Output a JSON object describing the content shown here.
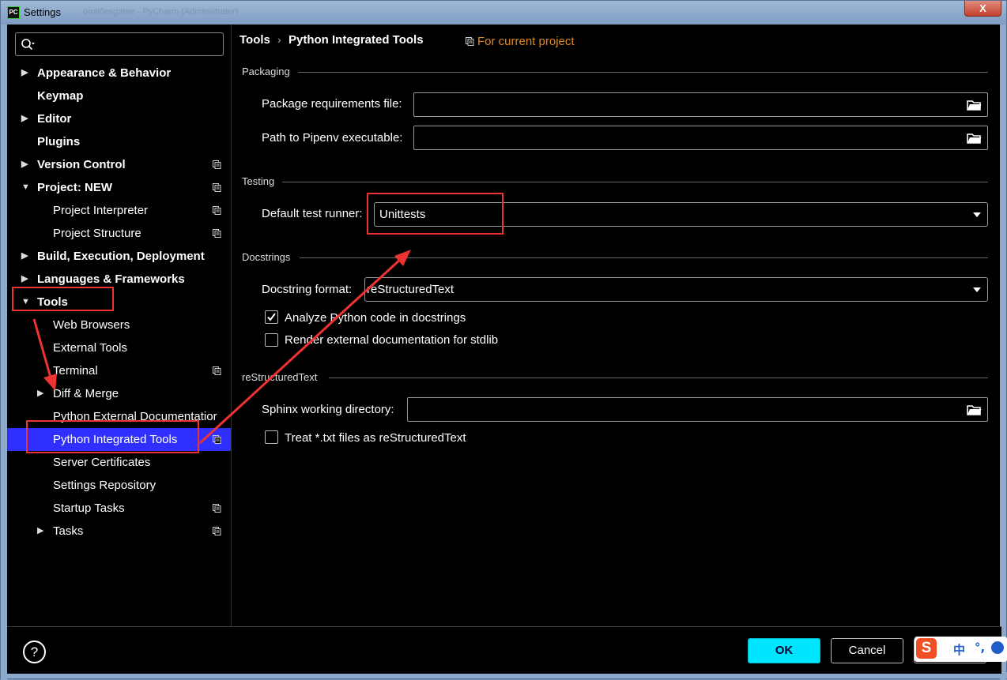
{
  "window": {
    "title": "Settings",
    "app_icon_text": "PC",
    "ghost_title": "...onal/lesgame - PyCharm (Administrator)",
    "close_label": "X"
  },
  "search": {
    "placeholder": ""
  },
  "sidebar": {
    "items": [
      {
        "label": "Appearance & Behavior",
        "bold": true,
        "arrow": "▶"
      },
      {
        "label": "Keymap",
        "bold": true,
        "arrow": ""
      },
      {
        "label": "Editor",
        "bold": true,
        "arrow": "▶"
      },
      {
        "label": "Plugins",
        "bold": true,
        "arrow": ""
      },
      {
        "label": "Version Control",
        "bold": true,
        "arrow": "▶"
      },
      {
        "label": "Project: NEW",
        "bold": true,
        "arrow": "▼"
      },
      {
        "label": "Project Interpreter",
        "bold": false,
        "arrow": ""
      },
      {
        "label": "Project Structure",
        "bold": false,
        "arrow": ""
      },
      {
        "label": "Build, Execution, Deployment",
        "bold": true,
        "arrow": "▶"
      },
      {
        "label": "Languages & Frameworks",
        "bold": true,
        "arrow": "▶"
      },
      {
        "label": "Tools",
        "bold": true,
        "arrow": "▼"
      },
      {
        "label": "Web Browsers",
        "bold": false,
        "arrow": ""
      },
      {
        "label": "External Tools",
        "bold": false,
        "arrow": ""
      },
      {
        "label": "Terminal",
        "bold": false,
        "arrow": ""
      },
      {
        "label": "Diff & Merge",
        "bold": false,
        "arrow": "▶"
      },
      {
        "label": "Python External Documentatior",
        "bold": false,
        "arrow": ""
      },
      {
        "label": "Python Integrated Tools",
        "bold": false,
        "arrow": "",
        "selected": true
      },
      {
        "label": "Server Certificates",
        "bold": false,
        "arrow": ""
      },
      {
        "label": "Settings Repository",
        "bold": false,
        "arrow": ""
      },
      {
        "label": "Startup Tasks",
        "bold": false,
        "arrow": ""
      },
      {
        "label": "Tasks",
        "bold": false,
        "arrow": "▶"
      }
    ]
  },
  "breadcrumb": {
    "parent": "Tools",
    "separator": "›",
    "current": "Python Integrated Tools"
  },
  "scope_label": "For current project",
  "packaging": {
    "section": "Packaging",
    "requirements_label": "Package requirements file:",
    "requirements_value": "",
    "pipenv_label": "Path to Pipenv executable:",
    "pipenv_value": ""
  },
  "testing": {
    "section": "Testing",
    "runner_label": "Default test runner:",
    "runner_value": "Unittests"
  },
  "docstrings": {
    "section": "Docstrings",
    "format_label": "Docstring format:",
    "format_value": "reStructuredText",
    "analyze_label": "Analyze Python code in docstrings",
    "analyze_checked": true,
    "render_label": "Render external documentation for stdlib",
    "render_checked": false
  },
  "rest": {
    "section": "reStructuredText",
    "sphinx_label": "Sphinx working directory:",
    "sphinx_value": "",
    "treat_label": "Treat *.txt files as reStructuredText",
    "treat_checked": false
  },
  "footer": {
    "help_label": "?",
    "ok_label": "OK",
    "cancel_label": "Cancel",
    "apply_label": ""
  },
  "ime": {
    "logo": "S",
    "lang": "中",
    "punct": "°,"
  },
  "colors": {
    "selection": "#2f2fff",
    "scope_text": "#e0871f",
    "ok_button": "#00e5ff",
    "annotation": "#ee3333"
  }
}
